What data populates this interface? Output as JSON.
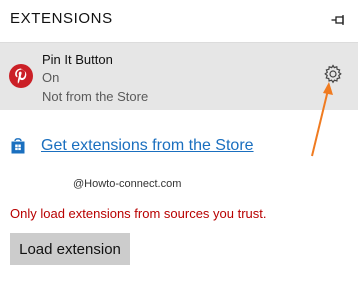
{
  "header": {
    "title": "EXTENSIONS",
    "pin_icon": "pin-icon"
  },
  "extension": {
    "name": "Pin It Button",
    "status": "On",
    "source": "Not from the Store",
    "logo_icon": "pinterest-logo",
    "settings_icon": "gear-icon",
    "logo_color": "#cb2027"
  },
  "annotation": {
    "arrow_color": "#f07b20"
  },
  "store": {
    "icon": "windows-store-icon",
    "link_label": "Get extensions from the Store",
    "link_color": "#1a6fbf"
  },
  "watermark": "@Howto-connect.com",
  "warning": {
    "text": "Only load extensions from sources you trust.",
    "color": "#b80000"
  },
  "actions": {
    "load_label": "Load extension"
  },
  "colors": {
    "row_background": "#e6e6e6",
    "button_background": "#cccccc"
  }
}
